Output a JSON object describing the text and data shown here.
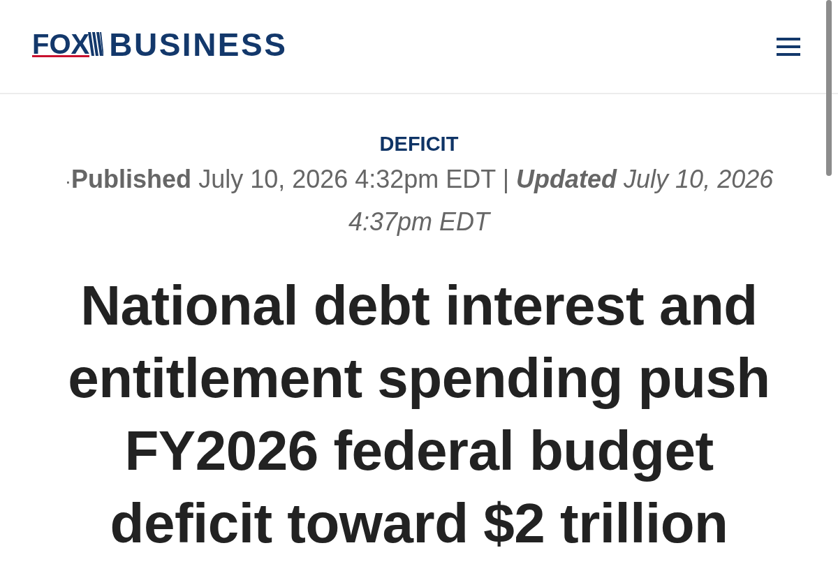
{
  "header": {
    "logo": {
      "fox": "FOX",
      "business": "BUSINESS"
    }
  },
  "article": {
    "category": "DEFICIT",
    "dateline": {
      "bullet": "·",
      "published_label": "Published",
      "published_time": "July 10, 2026 4:32pm EDT",
      "separator": "|",
      "updated_label": "Updated",
      "updated_time": "July 10, 2026 4:37pm EDT"
    },
    "headline": "National debt interest and entitlement spending push FY2026 federal budget deficit toward $2 trillion"
  }
}
